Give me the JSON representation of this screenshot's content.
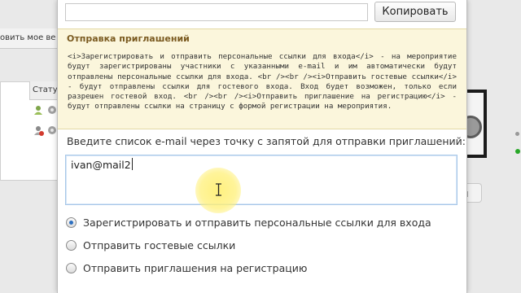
{
  "background": {
    "left_bar_text": "овить мое ве",
    "column_header": "Стату",
    "right_button_text": "ы"
  },
  "dialog": {
    "copy_button": "Копировать",
    "section_title": "Отправка приглашений",
    "info_text": "<i>Зарегистрировать и отправить персональные ссылки для входа</i> - на мероприятие будут зарегистрированы участники с указанными e-mail и им автоматически будут отправлены персональные ссылки для входа. <br /><br /><i>Отправить гостевые ссылки</i> - будут отправлены ссылки для гостевого входа. Вход будет возможен, только если разрешен гостевой вход. <br /><br /><i>Отправить приглашение на регистрацию</i> - будут отправлены ссылки на страницу с формой регистрации на мероприятия.",
    "email_label": "Введите список e-mail через точку с запятой для отправки приглашений:",
    "email_value": "ivan@mail2",
    "options": [
      {
        "label": "Зарегистрировать и отправить персональные ссылки для входа",
        "checked": true
      },
      {
        "label": "Отправить гостевые ссылки",
        "checked": false
      },
      {
        "label": "Отправить приглашения на регистрацию",
        "checked": false
      }
    ]
  },
  "colors": {
    "info_background": "#fbf6dc",
    "title_color": "#7a5a20",
    "radio_selected": "#2d6fc0"
  }
}
